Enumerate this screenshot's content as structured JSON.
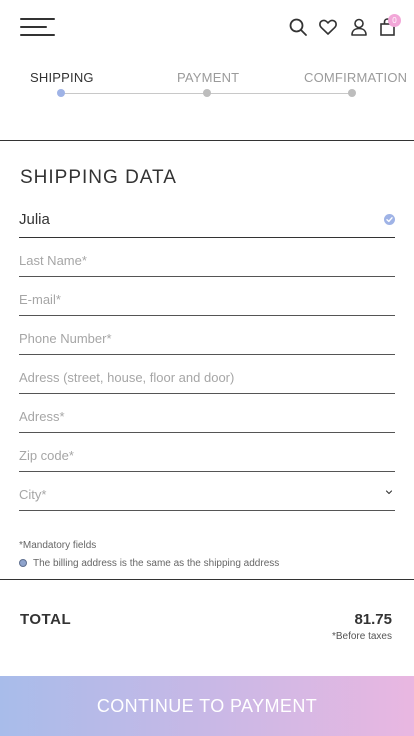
{
  "header": {
    "icons": [
      "menu-icon",
      "search-icon",
      "heart-icon",
      "user-icon",
      "bag-icon"
    ],
    "cart_count": "0"
  },
  "steps": [
    {
      "label": "SHIPPING",
      "active": true
    },
    {
      "label": "PAYMENT",
      "active": false
    },
    {
      "label": "COMFIRMATION",
      "active": false
    }
  ],
  "form": {
    "title": "SHIPPING DATA",
    "first_name": "Julia",
    "fields": [
      {
        "placeholder": "Last Name*"
      },
      {
        "placeholder": "E-mail*"
      },
      {
        "placeholder": "Phone Number*"
      },
      {
        "placeholder": "Adress (street, house, floor and door)"
      },
      {
        "placeholder": "Adress*"
      },
      {
        "placeholder": "Zip code*"
      },
      {
        "placeholder": "City*"
      }
    ],
    "mandatory_note": "*Mandatory fields",
    "billing_option": "The billing address is the same as the shipping address"
  },
  "summary": {
    "total_label": "TOTAL",
    "total_value": "81.75",
    "total_note": "*Before taxes"
  },
  "cta": {
    "label": "CONTINUE TO PAYMENT"
  },
  "colors": {
    "accent": "#9fb3e6",
    "badge": "#f2a7d8",
    "gradient_start": "#a8bcea",
    "gradient_end": "#e9b7e1"
  }
}
